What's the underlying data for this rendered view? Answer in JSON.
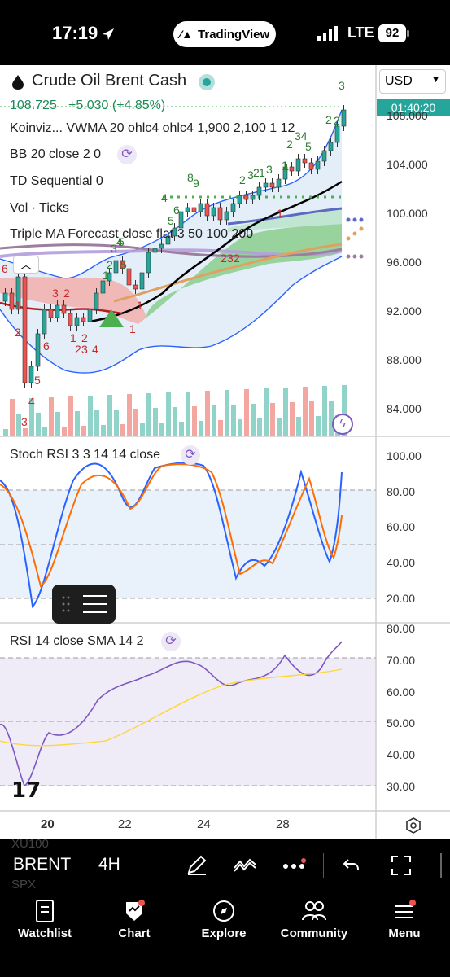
{
  "status_bar": {
    "time": "17:19",
    "app_pill": "TradingView",
    "network": "LTE",
    "battery": "92"
  },
  "header": {
    "symbol_name": "Crude Oil Brent Cash",
    "last_price": "108.725",
    "change": "+5.030 (+4.85%)",
    "currency": "USD",
    "countdown": "01:40:20"
  },
  "indicators": {
    "vwma": "Koinviz...  VWMA 20 ohlc4 ohlc4 1,900 2,100 1 12",
    "bb": "BB 20 close 2 0",
    "td": "TD Sequential 0",
    "vol": "Vol · Ticks",
    "triple_ma": "Triple MA Forecast close flat 3 50 100 200",
    "stoch": "Stoch RSI 3 3 14 14 close",
    "rsi": "RSI 14 close SMA 14 2"
  },
  "price_axis": [
    "108.000",
    "104.000",
    "100.000",
    "96.000",
    "92.000",
    "88.000",
    "84.000"
  ],
  "stoch_axis": [
    "100.00",
    "80.00",
    "60.00",
    "40.00",
    "20.00"
  ],
  "rsi_axis": [
    "80.00",
    "70.00",
    "60.00",
    "50.00",
    "40.00",
    "30.00"
  ],
  "time_axis": [
    "20",
    "22",
    "24",
    "28"
  ],
  "td_labels_green": [
    "3",
    "2",
    "34",
    "5",
    "2",
    "8",
    "9",
    "6",
    "4",
    "5",
    "2",
    "3",
    "1",
    "2",
    "3",
    "4",
    "5",
    "1",
    "2",
    "3",
    "4",
    "5",
    "2",
    "1"
  ],
  "td_labels_red": [
    "6",
    "1",
    "2",
    "3",
    "2",
    "6",
    "5",
    "4",
    "3",
    "2",
    "3",
    "4",
    "1",
    "2",
    "1",
    "1",
    "2",
    "3",
    "2",
    "1"
  ],
  "toolbar": {
    "symbol": "BRENT",
    "interval": "4H",
    "ghost_top": "XU100",
    "ghost_bottom": "SPX"
  },
  "tabs": [
    {
      "label": "Watchlist",
      "icon": "watchlist-icon"
    },
    {
      "label": "Chart",
      "icon": "chart-icon"
    },
    {
      "label": "Explore",
      "icon": "compass-icon"
    },
    {
      "label": "Community",
      "icon": "community-icon"
    },
    {
      "label": "Menu",
      "icon": "menu-icon"
    }
  ],
  "colors": {
    "up": "#26a69a",
    "down": "#ef5350",
    "td_green": "#2e7d32",
    "td_red": "#c62828",
    "stoch_k": "#2962ff",
    "stoch_d": "#ff6d00",
    "rsi_line": "#7e57c2",
    "rsi_sma": "#fdd835"
  }
}
